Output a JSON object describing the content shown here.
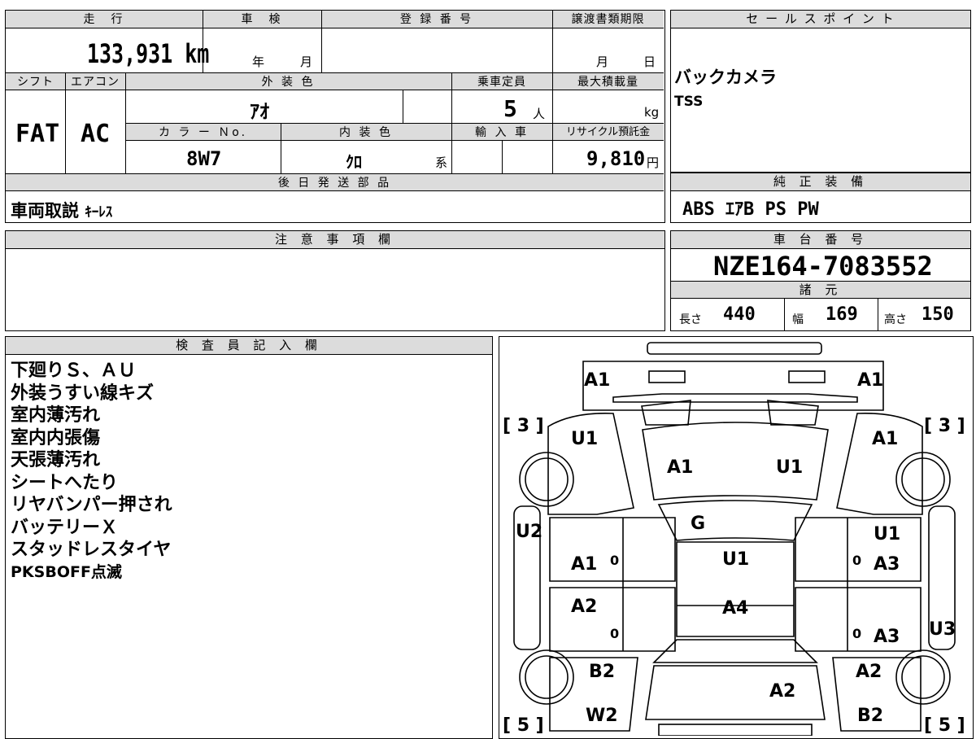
{
  "sheet": {
    "headers": {
      "mileage": "走　行",
      "inspection": "車　検",
      "registration": "登 録 番 号",
      "transfer_deadline": "譲渡書類期限",
      "sales_point": "セ ー ル ス ポ イ ン ト",
      "shift": "シフト",
      "aircon": "エアコン",
      "exterior_color": "外 装 色",
      "capacity": "乗車定員",
      "max_load": "最大積載量",
      "color_no": "カ ラ ー Ｎo.",
      "interior_color": "内 装 色",
      "import": "輸 入 車",
      "recycle_fee": "リサイクル預託金",
      "later_parts": "後 日 発 送 部 品",
      "genuine_equipment": "純 正 装 備",
      "notes": "注 意 事 項 欄",
      "chassis_number": "車 台 番 号",
      "specs": "諸 元",
      "inspector_notes": "検 査 員 記 入 欄"
    },
    "values": {
      "mileage": "133,931",
      "mileage_unit": "km",
      "year_label": "年",
      "month_label": "月",
      "transfer_month": "月",
      "transfer_day": "日",
      "shift": "FAT",
      "aircon": "AC",
      "exterior_color": "ｱｵ",
      "capacity": "5",
      "capacity_unit": "人",
      "load_unit": "kg",
      "color_no": "8W7",
      "interior_color": "ｸﾛ",
      "interior_suffix": "系",
      "recycle_fee": "9,810",
      "recycle_unit": "円",
      "sales_points": [
        "バックカメラ",
        "TSS"
      ],
      "later_parts_bold": "車両取説",
      "later_parts_item": "ｷｰﾚｽ",
      "equipment": "ABS ｴｱB PS PW",
      "chassis_number": "NZE164-7083552",
      "length_label": "長さ",
      "length": "440",
      "width_label": "幅",
      "width": "169",
      "height_label": "高さ",
      "height": "150"
    },
    "inspector_notes": [
      "下廻りＳ、ＡＵ",
      "外装うすい線キズ",
      "室内薄汚れ",
      "室内内張傷",
      "天張薄汚れ",
      "シートへたり",
      "リヤバンパー押され",
      "バッテリーＸ",
      "スタッドレスタイヤ",
      "PKSBOFF点滅"
    ]
  },
  "car_diagram": {
    "labels": {
      "front_left_corner": "A1",
      "front_right_corner": "A1",
      "tire_fl": "[ 3 ]",
      "tire_fr": "[ 3 ]",
      "fender_left": "U1",
      "fender_right": "A1",
      "hood_left": "A1",
      "hood_right": "U1",
      "windshield": "G",
      "roof": "U1",
      "roof_rear": "A4",
      "pillar_left": "U2",
      "front_door_left": "A1",
      "front_door_left_code": "0",
      "rear_door_left": "A2",
      "rear_door_left_code": "0",
      "front_door_right_top": "U1",
      "front_door_right": "A3",
      "front_door_right_code": "0",
      "rear_door_right": "A3",
      "rear_door_right_code": "0",
      "rocker_right": "U3",
      "quarter_left": "B2",
      "quarter_right": "A2",
      "trunk": "A2",
      "rear_left": "W2",
      "rear_right": "B2",
      "tire_rl": "[ 5 ]",
      "tire_rr": "[ 5 ]"
    }
  }
}
